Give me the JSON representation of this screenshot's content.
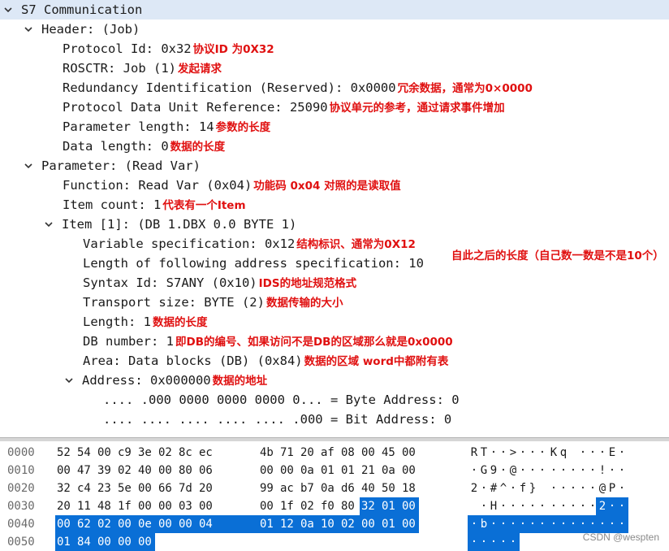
{
  "tree": {
    "rows": [
      {
        "text": "S7 Communication",
        "arrow": "down",
        "level": 0,
        "note": ""
      },
      {
        "text": "Header: (Job)",
        "arrow": "down",
        "level": 1,
        "note": ""
      },
      {
        "text": "Protocol Id: 0x32",
        "arrow": "",
        "level": 2,
        "note": "协议ID 为0X32"
      },
      {
        "text": "ROSCTR: Job (1)",
        "arrow": "",
        "level": 2,
        "note": "发起请求"
      },
      {
        "text": "Redundancy Identification (Reserved): 0x0000",
        "arrow": "",
        "level": 2,
        "note": "冗余数据，通常为0×0000"
      },
      {
        "text": "Protocol Data Unit Reference: 25090",
        "arrow": "",
        "level": 2,
        "note": "协议单元的参考，通过请求事件增加"
      },
      {
        "text": "Parameter length: 14",
        "arrow": "",
        "level": 2,
        "note": "参数的长度"
      },
      {
        "text": "Data length: 0",
        "arrow": "",
        "level": 2,
        "note": "数据的长度"
      },
      {
        "text": "Parameter: (Read Var)",
        "arrow": "down",
        "level": 1,
        "note": ""
      },
      {
        "text": "Function: Read Var (0x04)",
        "arrow": "",
        "level": 2,
        "note": "功能码 0x04 对照的是读取值"
      },
      {
        "text": "Item count: 1",
        "arrow": "",
        "level": 2,
        "note": "代表有一个Item"
      },
      {
        "text": "Item [1]: (DB 1.DBX 0.0 BYTE 1)",
        "arrow": "down",
        "level": 2,
        "note": ""
      },
      {
        "text": "Variable specification: 0x12",
        "arrow": "",
        "level": 3,
        "note": "结构标识、通常为0X12"
      },
      {
        "text": "Length of following address specification: 10",
        "arrow": "",
        "level": 3,
        "note": ""
      },
      {
        "text": "Syntax Id: S7ANY (0x10)",
        "arrow": "",
        "level": 3,
        "note": "IDS的地址规范格式"
      },
      {
        "text": "Transport size: BYTE (2)",
        "arrow": "",
        "level": 3,
        "note": "数据传输的大小"
      },
      {
        "text": "Length: 1",
        "arrow": "",
        "level": 3,
        "note": "数据的长度"
      },
      {
        "text": "DB number: 1",
        "arrow": "",
        "level": 3,
        "note": "即DB的编号、如果访问不是DB的区域那么就是0x0000"
      },
      {
        "text": "Area: Data blocks (DB) (0x84)",
        "arrow": "",
        "level": 3,
        "note": "数据的区域 word中都附有表"
      },
      {
        "text": "Address: 0x000000",
        "arrow": "down",
        "level": 3,
        "note": "数据的地址"
      },
      {
        "text": ".... .000 0000 0000 0000 0... = Byte Address: 0",
        "arrow": "",
        "level": 4,
        "note": ""
      },
      {
        "text": ".... .... .... .... .... .000 = Bit Address: 0",
        "arrow": "",
        "level": 4,
        "note": ""
      }
    ],
    "length_note": "自此之后的长度（自己数一数是不是10个）"
  },
  "hex": {
    "rows": [
      {
        "offset": "0000",
        "bytes": [
          "52",
          "54",
          "00",
          "c9",
          "3e",
          "02",
          "8c",
          "ec",
          "4b",
          "71",
          "20",
          "af",
          "08",
          "00",
          "45",
          "00"
        ],
        "ascii": [
          "R",
          "T",
          "·",
          "·",
          ">",
          "·",
          "·",
          "·",
          "K",
          "q",
          " ",
          "·",
          "·",
          "·",
          "E",
          "·"
        ],
        "sel_from": 16
      },
      {
        "offset": "0010",
        "bytes": [
          "00",
          "47",
          "39",
          "02",
          "40",
          "00",
          "80",
          "06",
          "00",
          "00",
          "0a",
          "01",
          "01",
          "21",
          "0a",
          "00"
        ],
        "ascii": [
          "·",
          "G",
          "9",
          "·",
          "@",
          "·",
          "·",
          "·",
          "·",
          "·",
          "·",
          "·",
          "·",
          "!",
          "·",
          "·"
        ],
        "sel_from": 16
      },
      {
        "offset": "0020",
        "bytes": [
          "32",
          "c4",
          "23",
          "5e",
          "00",
          "66",
          "7d",
          "20",
          "99",
          "ac",
          "b7",
          "0a",
          "d6",
          "40",
          "50",
          "18"
        ],
        "ascii": [
          "2",
          "·",
          "#",
          "^",
          "·",
          "f",
          "}",
          " ",
          "·",
          "·",
          "·",
          "·",
          "·",
          "@",
          "P",
          "·"
        ],
        "sel_from": 16
      },
      {
        "offset": "0030",
        "bytes": [
          "20",
          "11",
          "48",
          "1f",
          "00",
          "00",
          "03",
          "00",
          "00",
          "1f",
          "02",
          "f0",
          "80",
          "32",
          "01",
          "00"
        ],
        "ascii": [
          " ",
          "·",
          "H",
          "·",
          "·",
          "·",
          "·",
          "·",
          "·",
          "·",
          "·",
          "·",
          "·",
          "2",
          "·",
          "·"
        ],
        "sel_from": 13
      },
      {
        "offset": "0040",
        "bytes": [
          "00",
          "62",
          "02",
          "00",
          "0e",
          "00",
          "00",
          "04",
          "01",
          "12",
          "0a",
          "10",
          "02",
          "00",
          "01",
          "00"
        ],
        "ascii": [
          "·",
          "b",
          "·",
          "·",
          "·",
          "·",
          "·",
          "·",
          "·",
          "·",
          "·",
          "·",
          "·",
          "·",
          "·",
          "·"
        ],
        "sel_from": 0
      },
      {
        "offset": "0050",
        "bytes": [
          "01",
          "84",
          "00",
          "00",
          "00"
        ],
        "ascii": [
          "·",
          "·",
          "·",
          "·",
          "·"
        ],
        "sel_from": 0
      }
    ]
  },
  "colors": {
    "selection": "#0a6fd6",
    "annotation": "#e01010",
    "header_bg": "#dde8f6"
  },
  "watermark": "CSDN @wespten"
}
